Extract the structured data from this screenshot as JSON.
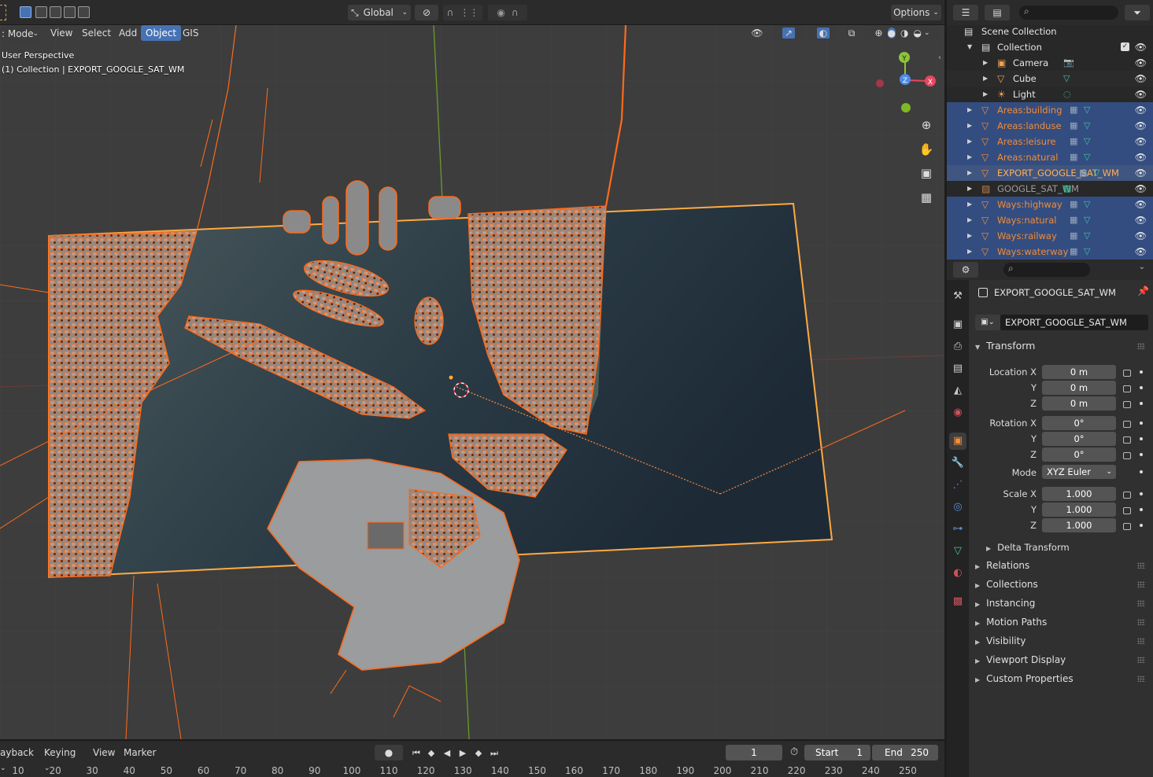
{
  "header": {
    "mode_label": "Object Mode",
    "mode_visible": ": Mode",
    "menus": [
      "View",
      "Select",
      "Add",
      "Object",
      "GIS"
    ],
    "active_menu": "Object",
    "transform_orientation": "Global",
    "options_label": "Options"
  },
  "viewport": {
    "perspective_label": "User Perspective",
    "context_label": "(1) Collection | EXPORT_GOOGLE_SAT_WM",
    "gizmo_axes": [
      "X",
      "Y",
      "Z"
    ]
  },
  "timeline": {
    "menus": [
      "Playback",
      "Keying",
      "View",
      "Marker"
    ],
    "playback_visible": "ayback",
    "current_frame": "1",
    "start_label": "Start",
    "start_value": "1",
    "end_label": "End",
    "end_value": "250",
    "ruler": [
      "10",
      "20",
      "30",
      "40",
      "50",
      "60",
      "70",
      "80",
      "90",
      "100",
      "110",
      "120",
      "130",
      "140",
      "150",
      "160",
      "170",
      "180",
      "190",
      "200",
      "210",
      "220",
      "230",
      "240",
      "250"
    ]
  },
  "outliner": {
    "search_placeholder": "",
    "scene_collection": "Scene Collection",
    "collection": "Collection",
    "items": [
      {
        "label": "Camera",
        "state": "normal"
      },
      {
        "label": "Cube",
        "state": "normal"
      },
      {
        "label": "Light",
        "state": "normal"
      },
      {
        "label": "Areas:building",
        "state": "selected"
      },
      {
        "label": "Areas:landuse",
        "state": "selected"
      },
      {
        "label": "Areas:leisure",
        "state": "selected"
      },
      {
        "label": "Areas:natural",
        "state": "selected"
      },
      {
        "label": "EXPORT_GOOGLE_SAT_WM",
        "state": "active"
      },
      {
        "label": "GOOGLE_SAT_WM",
        "state": "normal"
      },
      {
        "label": "Ways:highway",
        "state": "selected"
      },
      {
        "label": "Ways:natural",
        "state": "selected"
      },
      {
        "label": "Ways:railway",
        "state": "selected"
      },
      {
        "label": "Ways:waterway",
        "state": "selected"
      }
    ]
  },
  "properties": {
    "object_name_header": "EXPORT_GOOGLE_SAT_WM",
    "object_name_field": "EXPORT_GOOGLE_SAT_WM",
    "transform_title": "Transform",
    "location": {
      "label": "Location X",
      "x": "0 m",
      "y": "0 m",
      "z": "0 m"
    },
    "rotation": {
      "label": "Rotation X",
      "x": "0°",
      "y": "0°",
      "z": "0°"
    },
    "mode_label": "Mode",
    "mode_value": "XYZ Euler",
    "scale": {
      "label": "Scale X",
      "x": "1.000",
      "y": "1.000",
      "z": "1.000"
    },
    "axis_y": "Y",
    "axis_z": "Z",
    "delta_transform": "Delta Transform",
    "panels": [
      "Relations",
      "Collections",
      "Instancing",
      "Motion Paths",
      "Visibility",
      "Viewport Display",
      "Custom Properties"
    ]
  },
  "colors": {
    "accent": "#4772b3",
    "selection_orange": "#f28c38",
    "active_orange": "#ffaa40",
    "outliner_selected": "#334d80"
  }
}
